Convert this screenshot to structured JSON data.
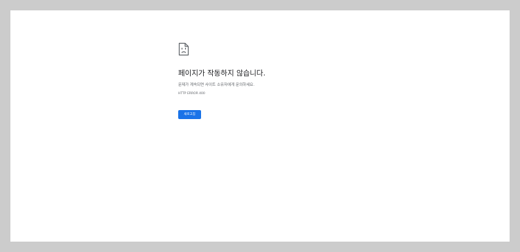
{
  "error": {
    "icon": "sad-document-icon",
    "title": "페이지가 작동하지 않습니다.",
    "description": "문제가 계속되면 사이트 소유자에게 문의하세요.",
    "code": "HTTP ERROR 400"
  },
  "actions": {
    "reload_label": "새로고침"
  },
  "colors": {
    "page_background": "#ffffff",
    "outer_background": "#cccccc",
    "button_background": "#1a73e8",
    "title_text": "#202124",
    "secondary_text": "#5f6368"
  }
}
